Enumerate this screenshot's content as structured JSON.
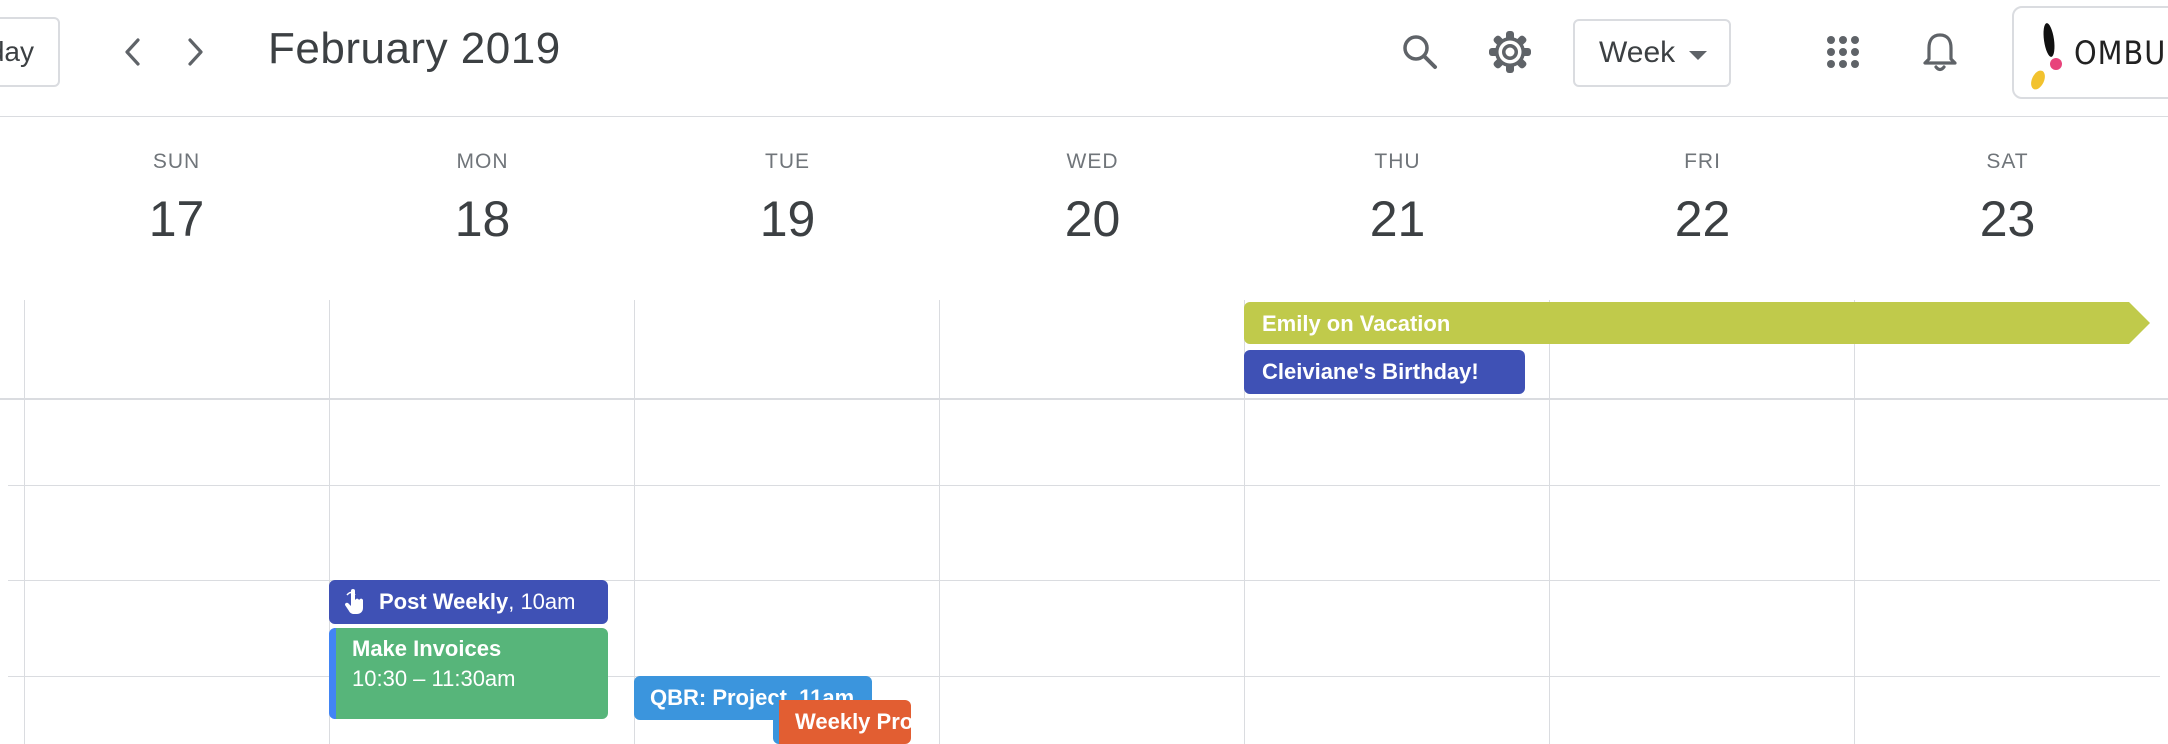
{
  "header": {
    "today_label": "Today",
    "title": "February 2019",
    "view_selected": "Week",
    "logo_text": "OMBULABS"
  },
  "days": [
    {
      "name": "SUN",
      "num": "17"
    },
    {
      "name": "MON",
      "num": "18"
    },
    {
      "name": "TUE",
      "num": "19"
    },
    {
      "name": "WED",
      "num": "20"
    },
    {
      "name": "THU",
      "num": "21"
    },
    {
      "name": "FRI",
      "num": "22"
    },
    {
      "name": "SAT",
      "num": "23"
    }
  ],
  "events": {
    "vacation": {
      "title": "Emily on Vacation",
      "color": "#c0ca4b"
    },
    "birthday": {
      "title": "Cleiviane's Birthday!",
      "color": "#3f51b5"
    },
    "post_weekly": {
      "title": "Post Weekly",
      "time": ", 10am",
      "color": "#3f51b5"
    },
    "invoices": {
      "title": "Make Invoices",
      "time": "10:30 – 11:30am",
      "color": "#57b57a"
    },
    "qbr": {
      "title": "QBR: Project, 11am",
      "color": "#3b95dd"
    },
    "weekly_pro": {
      "title": "Weekly Pro",
      "color": "#e25e32"
    }
  },
  "icons": {
    "prev": "chevron-left-icon",
    "next": "chevron-right-icon",
    "search": "search-icon",
    "settings": "gear-icon",
    "apps": "apps-grid-icon",
    "notifications": "bell-icon",
    "event_type": "hand-pointer-icon"
  },
  "colors": {
    "grid_line": "#dadce0",
    "text_primary": "#3c4043",
    "text_secondary": "#70757a"
  }
}
